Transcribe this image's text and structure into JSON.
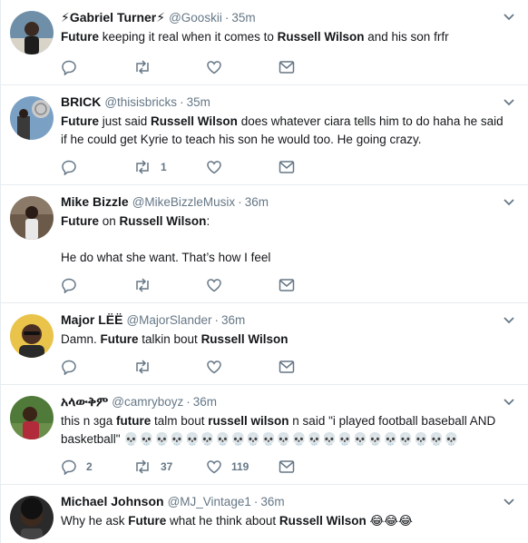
{
  "tweets": [
    {
      "name": "⚡Gabriel Turner⚡",
      "handle": "@Gooskii",
      "time": "35m",
      "segments": [
        {
          "t": "Future",
          "b": true
        },
        {
          "t": " keeping it real when it comes to ",
          "b": false
        },
        {
          "t": "Russell Wilson",
          "b": true
        },
        {
          "t": " and his son frfr",
          "b": false
        }
      ],
      "counts": {
        "reply": "",
        "retweet": "",
        "like": ""
      }
    },
    {
      "name": "BRICK",
      "handle": "@thisisbricks",
      "time": "35m",
      "segments": [
        {
          "t": "Future",
          "b": true
        },
        {
          "t": " just said ",
          "b": false
        },
        {
          "t": "Russell Wilson",
          "b": true
        },
        {
          "t": " does whatever ciara tells him to do haha he said\nif he could get Kyrie to teach his son he would too. He going crazy.",
          "b": false
        }
      ],
      "counts": {
        "reply": "",
        "retweet": "1",
        "like": ""
      }
    },
    {
      "name": "Mike Bizzle",
      "handle": "@MikeBizzleMusix",
      "time": "36m",
      "segments": [
        {
          "t": "Future",
          "b": true
        },
        {
          "t": " on ",
          "b": false
        },
        {
          "t": "Russell Wilson",
          "b": true
        },
        {
          "t": ":\n\nHe do what she want. That’s how I feel",
          "b": false
        }
      ],
      "counts": {
        "reply": "",
        "retweet": "",
        "like": ""
      }
    },
    {
      "name": "Major LËË",
      "handle": "@MajorSlander",
      "time": "36m",
      "segments": [
        {
          "t": "Damn. ",
          "b": false
        },
        {
          "t": "Future",
          "b": true
        },
        {
          "t": " talkin bout ",
          "b": false
        },
        {
          "t": "Russell Wilson",
          "b": true
        }
      ],
      "counts": {
        "reply": "",
        "retweet": "",
        "like": ""
      }
    },
    {
      "name": "አላውቅም",
      "handle": "@camryboyz",
      "time": "36m",
      "segments": [
        {
          "t": "this n ɜga ",
          "b": false
        },
        {
          "t": "future",
          "b": true
        },
        {
          "t": " talm bout ",
          "b": false
        },
        {
          "t": "russell wilson",
          "b": true
        },
        {
          "t": " n said \"i played football baseball AND\nbasketball\" 💀💀💀💀💀💀💀💀💀💀💀💀💀💀💀💀💀💀💀💀💀💀",
          "b": false
        }
      ],
      "counts": {
        "reply": "2",
        "retweet": "37",
        "like": "119"
      }
    },
    {
      "name": "Michael Johnson",
      "handle": "@MJ_Vintage1",
      "time": "36m",
      "segments": [
        {
          "t": "Why he ask ",
          "b": false
        },
        {
          "t": "Future",
          "b": true
        },
        {
          "t": " what he think about ",
          "b": false
        },
        {
          "t": "Russell Wilson",
          "b": true
        },
        {
          "t": " 😂😂😂",
          "b": false
        }
      ],
      "counts": {
        "reply": "",
        "retweet": "",
        "like": ""
      }
    }
  ],
  "icons": {
    "reply": "reply-icon",
    "retweet": "retweet-icon",
    "like": "heart-icon",
    "dm": "envelope-icon",
    "caret": "chevron-down-icon"
  },
  "colors": {
    "text": "#14171a",
    "secondary": "#657786",
    "divider": "#e6ecf0"
  }
}
